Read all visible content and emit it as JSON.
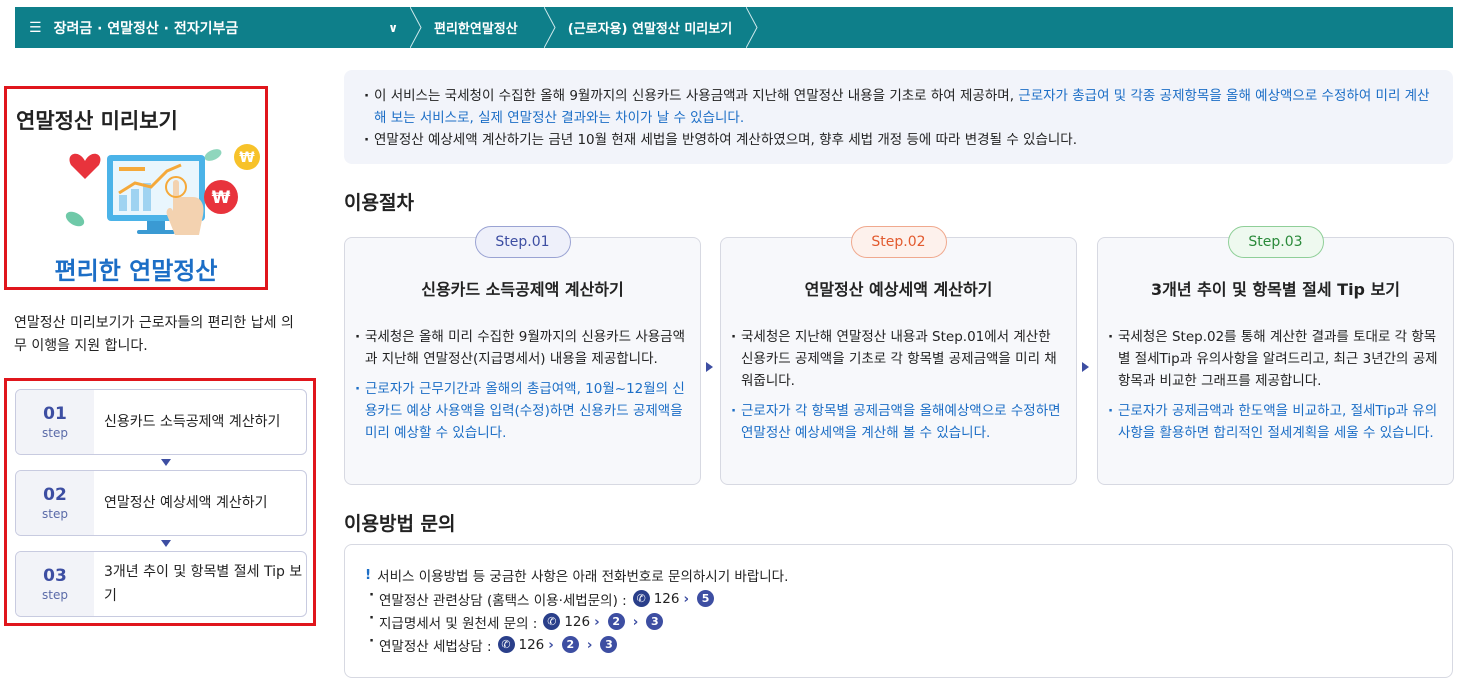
{
  "topnav": {
    "menu_label": "장려금 · 연말정산 · 전자기부금",
    "menu_icon": "hamburger-icon",
    "crumbs": [
      "편리한연말정산",
      "(근로자용) 연말정산 미리보기"
    ]
  },
  "promo": {
    "title": "연말정산 미리보기",
    "subtitle": "편리한 연말정산",
    "coin_symbol": "₩"
  },
  "description": "연말정산 미리보기가 근로자들의  편리한 납세 의무 이행을 지원 합니다.",
  "side_steps": [
    {
      "num": "01",
      "step": "step",
      "label": "신용카드 소득공제액 계산하기"
    },
    {
      "num": "02",
      "step": "step",
      "label": "연말정산 예상세액 계산하기"
    },
    {
      "num": "03",
      "step": "step",
      "label": "3개년 추이 및 항목별 절세 Tip 보기"
    }
  ],
  "notice": {
    "line1_black": "이 서비스는 국세청이 수집한 올해 9월까지의 신용카드 사용금액과 지난해 연말정산 내용을 기초로 하여 제공하며, ",
    "line1_blue": "근로자가 총급여 및 각종 공제항목을 올해 예상액으로 수정하여 미리 계산해 보는 서비스로, 실제 연말정산 결과와는 차이가 날 수 있습니다.",
    "line2": "연말정산 예상세액 계산하기는 금년 10월 현재 세법을 반영하여 계산하였으며, 향후 세법 개정 등에 따라 변경될 수 있습니다."
  },
  "procedure": {
    "heading": "이용절차",
    "cards": [
      {
        "badge": "Step.01",
        "title": "신용카드 소득공제액 계산하기",
        "text1": "국세청은 올해 미리 수집한 9월까지의 신용카드 사용금액과 지난해 연말정산(지급명세서) 내용을 제공합니다.",
        "text2": "근로자가 근무기간과 올해의 총급여액, 10월~12월의 신용카드 예상 사용액을 입력(수정)하면 신용카드 공제액을 미리 예상할 수 있습니다."
      },
      {
        "badge": "Step.02",
        "title": "연말정산 예상세액 계산하기",
        "text1": "국세청은 지난해 연말정산 내용과 Step.01에서 계산한 신용카드 공제액을 기초로 각 항목별 공제금액을 미리 채워줍니다.",
        "text2": "근로자가 각 항목별 공제금액을 올해예상액으로 수정하면 연말정산 예상세액을 계산해 볼 수 있습니다."
      },
      {
        "badge": "Step.03",
        "title": "3개년 추이 및 항목별 절세 Tip 보기",
        "text1": "국세청은 Step.02를 통해 계산한 결과를 토대로 각 항목별 절세Tip과 유의사항을 알려드리고, 최근 3년간의 공제항목과 비교한 그래프를 제공합니다.",
        "text2": "근로자가 공제금액과 한도액을 비교하고, 절세Tip과 유의사항을 활용하면 합리적인 절세계획을 세울 수 있습니다."
      }
    ],
    "colors": {
      "step1": "#3d4ea2",
      "step2": "#e25a2e",
      "step3": "#2a8a3a"
    }
  },
  "inquiry": {
    "heading": "이용방법 문의",
    "lead_mark": "!",
    "lead": "서비스 이용방법 등 궁금한 사항은 아래 전화번호로 문의하시기 바랍니다.",
    "rows": [
      {
        "label": "연말정산 관련상담 (홈택스 이용·세법문의) :",
        "phone": "126",
        "options": [
          "5"
        ]
      },
      {
        "label": "지급명세서 및 원천세 문의 :",
        "phone": "126",
        "options": [
          "2",
          "3"
        ]
      },
      {
        "label": "연말정산 세법상담 :",
        "phone": "126",
        "options": [
          "2",
          "3"
        ]
      }
    ],
    "phone_icon": "phone-icon"
  }
}
